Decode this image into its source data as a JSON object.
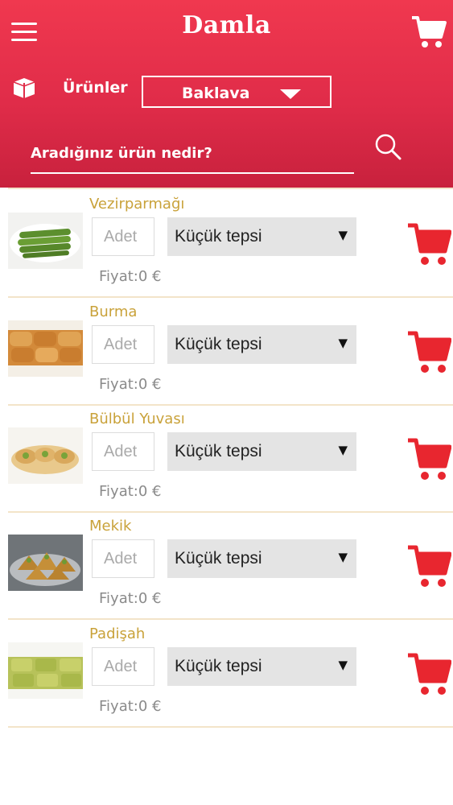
{
  "header": {
    "title": "Damla",
    "menu_icon": "hamburger-menu-icon",
    "cart_icon": "shopping-cart-icon",
    "category_label": "Ürünler",
    "category_selected": "Baklava",
    "search_placeholder": "Aradığınız ürün nedir?",
    "search_icon": "search-icon"
  },
  "colors": {
    "header_top": "#f0384f",
    "header_bottom": "#c8213d",
    "product_name": "#c9a23a",
    "cart_red": "#e8262f",
    "divider": "#f3e4c9"
  },
  "products": [
    {
      "name": "Vezirparmağı",
      "qty_placeholder": "Adet",
      "size": "Küçük tepsi",
      "price": "Fiyat:0 €"
    },
    {
      "name": "Burma",
      "qty_placeholder": "Adet",
      "size": "Küçük tepsi",
      "price": "Fiyat:0 €"
    },
    {
      "name": "Bülbül Yuvası",
      "qty_placeholder": "Adet",
      "size": "Küçük tepsi",
      "price": "Fiyat:0 €"
    },
    {
      "name": "Mekik",
      "qty_placeholder": "Adet",
      "size": "Küçük tepsi",
      "price": "Fiyat:0 €"
    },
    {
      "name": "Padişah",
      "qty_placeholder": "Adet",
      "size": "Küçük tepsi",
      "price": "Fiyat:0 €"
    }
  ]
}
